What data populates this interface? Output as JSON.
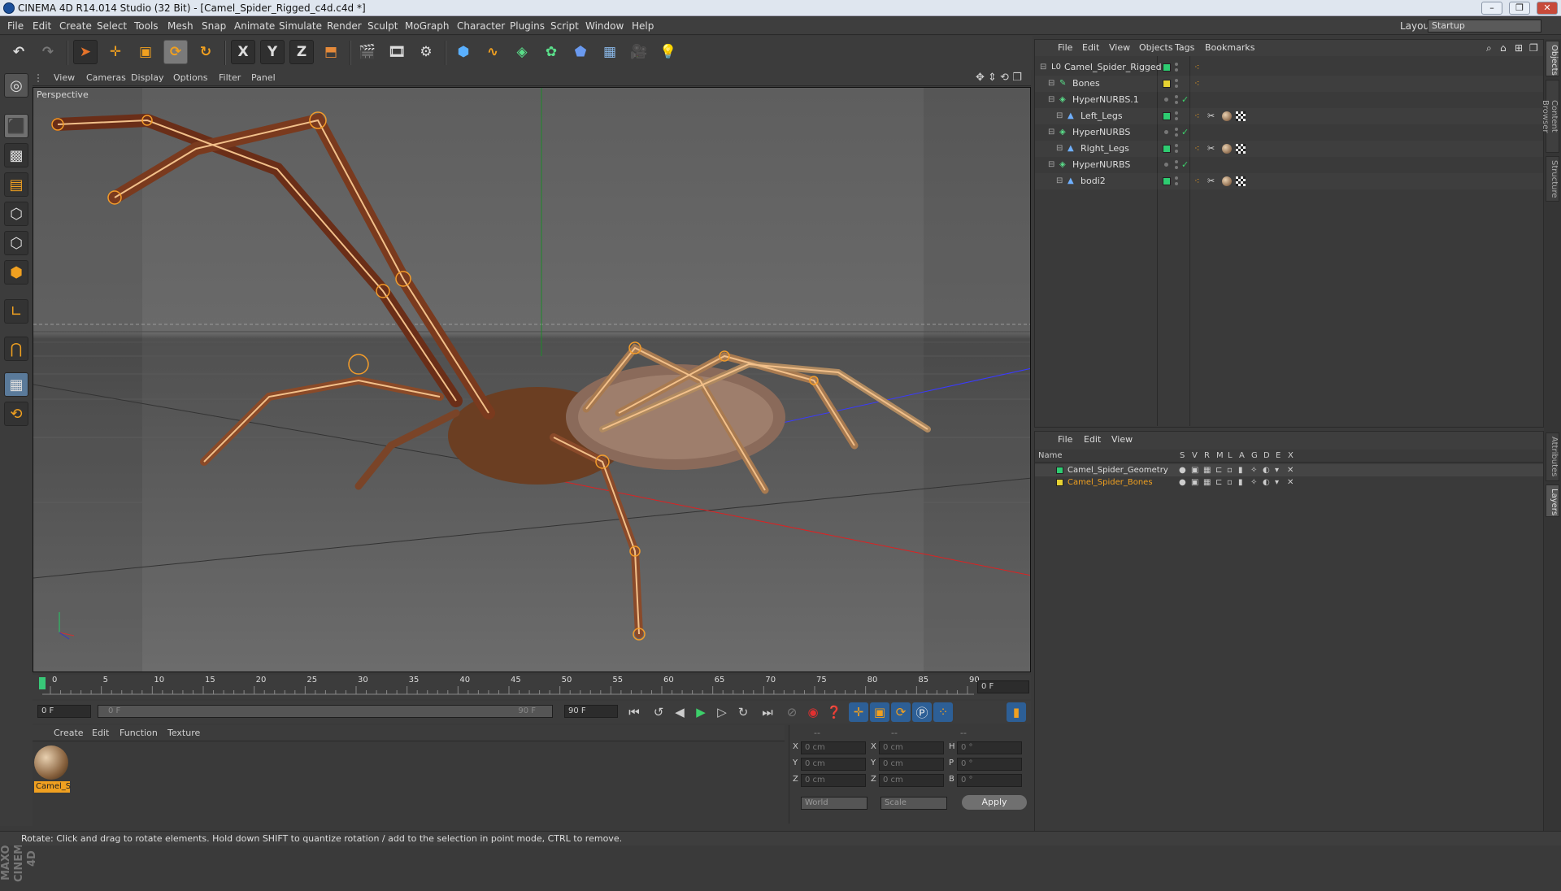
{
  "window": {
    "title": "CINEMA 4D R14.014 Studio (32 Bit) - [Camel_Spider_Rigged_c4d.c4d *]",
    "min": "–",
    "max": "❐",
    "close": "✕"
  },
  "menubar": {
    "items": [
      "File",
      "Edit",
      "Create",
      "Select",
      "Tools",
      "Mesh",
      "Snap",
      "Animate",
      "Simulate",
      "Render",
      "Sculpt",
      "MoGraph",
      "Character",
      "Plugins",
      "Script",
      "Window",
      "Help"
    ],
    "layout_label": "Layout:",
    "layout_value": "Startup"
  },
  "toolbar": {
    "axis_x": "X",
    "axis_y": "Y",
    "axis_z": "Z"
  },
  "viewport": {
    "menu": [
      "View",
      "Cameras",
      "Display",
      "Options",
      "Filter",
      "Panel"
    ],
    "label": "Perspective"
  },
  "timeline": {
    "ticks": [
      "0",
      "5",
      "10",
      "15",
      "20",
      "25",
      "30",
      "35",
      "40",
      "45",
      "50",
      "55",
      "60",
      "65",
      "70",
      "75",
      "80",
      "85",
      "90"
    ],
    "current_frame": "0 F"
  },
  "transport": {
    "start": "0 F",
    "range_start": "0 F",
    "range_end": "90 F",
    "end": "90 F"
  },
  "material_manager": {
    "menu": [
      "Create",
      "Edit",
      "Function",
      "Texture"
    ],
    "material_name": "Camel_S"
  },
  "coordinates": {
    "header": [
      "--",
      "--",
      "--"
    ],
    "rows": [
      {
        "a": "X",
        "v1": "0 cm",
        "b": "X",
        "v2": "0 cm",
        "c": "H",
        "v3": "0 °"
      },
      {
        "a": "Y",
        "v1": "0 cm",
        "b": "Y",
        "v2": "0 cm",
        "c": "P",
        "v3": "0 °"
      },
      {
        "a": "Z",
        "v1": "0 cm",
        "b": "Z",
        "v2": "0 cm",
        "c": "B",
        "v3": "0 °"
      }
    ],
    "world": "World",
    "scale": "Scale",
    "apply": "Apply"
  },
  "object_manager": {
    "menu": [
      "File",
      "Edit",
      "View",
      "Objects",
      "Tags",
      "Bookmarks"
    ],
    "objects": [
      {
        "name": "Camel_Spider_Rigged",
        "color": "#2ecc71",
        "indent": 0
      },
      {
        "name": "Bones",
        "color": "#e6d232",
        "indent": 1
      },
      {
        "name": "HyperNURBS.1",
        "color": "",
        "indent": 1
      },
      {
        "name": "Left_Legs",
        "color": "#2ecc71",
        "indent": 2
      },
      {
        "name": "HyperNURBS",
        "color": "",
        "indent": 1
      },
      {
        "name": "Right_Legs",
        "color": "#2ecc71",
        "indent": 2
      },
      {
        "name": "HyperNURBS",
        "color": "",
        "indent": 1
      },
      {
        "name": "bodi2",
        "color": "#2ecc71",
        "indent": 2
      }
    ]
  },
  "layer_manager": {
    "menu": [
      "File",
      "Edit",
      "View"
    ],
    "columns": [
      "Name",
      "S",
      "V",
      "R",
      "M",
      "L",
      "A",
      "G",
      "D",
      "E",
      "X"
    ],
    "layers": [
      {
        "name": "Camel_Spider_Geometry",
        "color": "#2ecc71"
      },
      {
        "name": "Camel_Spider_Bones",
        "color": "#e6d232"
      }
    ]
  },
  "side_tabs": {
    "top": [
      "Objects",
      "Content Browser",
      "Structure"
    ],
    "bottom": [
      "Attributes",
      "Layers"
    ]
  },
  "status": {
    "text": "Rotate: Click and drag to rotate elements. Hold down SHIFT to quantize rotation / add to the selection in point mode, CTRL to remove."
  },
  "brand": {
    "logo": "MAXON CINEMA 4D"
  }
}
